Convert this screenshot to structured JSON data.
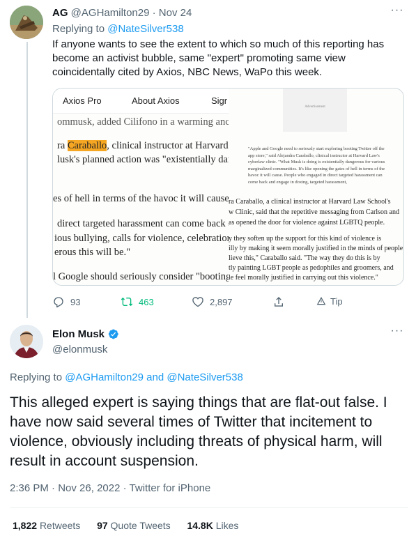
{
  "tweet1": {
    "author_name": "AG",
    "author_handle": "@AGHamilton29",
    "separator": "·",
    "date": "Nov 24",
    "replying_prefix": "Replying to",
    "replying_to": "@NateSilver538",
    "body": "If anyone wants to see the extent to which so much of this reporting has become an activist bubble, same \"expert\" promoting same view coincidentally cited by Axios, NBC News, WaPo this week.",
    "media": {
      "nav_items": [
        "Axios Pro",
        "About Axios",
        "Sigr"
      ],
      "left_lines": [
        "ommusk, added Cilifono in a warming anc",
        "ra ",
        "Caraballo",
        ", clinical instructor at Harvard",
        "lusk's planned action was \"existentially dan",
        "es of hell in terms of the havoc it will cause,",
        "direct targeted harassment can come back a",
        "ious bullying, calls for violence, celebration",
        "erous this will be.\"",
        "l Google should seriously consider \"booting"
      ],
      "ad_label": "Advertisement",
      "small_quote": "\"Apple and Google need to seriously start exploring booting Twitter off the app store,\" said Alejandra Caraballo, clinical instructor at Harvard Law's cyberlaw clinic. \"What Musk is doing is existentially dangerous for various marginalized communities. It's like opening the gates of hell in terms of the havoc it will cause. People who engaged in direct targeted harassment can come back and engage in doxing, targeted harassment,",
      "right_lines": [
        "ra Caraballo, a clinical instructor at Harvard Law School's",
        "w Clinic, said that the repetitive messaging from Carlson and",
        "as opened the door for violence against LGBTQ people.",
        "y they soften up the support for this kind of violence is",
        "illy by making it seem morally justified in the minds of people",
        "lieve this,\" Caraballo said. \"The way they do this is by",
        "tly painting LGBT people as pedophiles and groomers, and",
        "le feel morally justified in carrying out this violence.\""
      ]
    },
    "actions": {
      "replies": "93",
      "retweets": "463",
      "likes": "2,897",
      "tip": "Tip"
    }
  },
  "tweet2": {
    "author_name": "Elon Musk",
    "author_handle": "@elonmusk",
    "replying_prefix": "Replying to",
    "replying_to_1": "@AGHamilton29",
    "replying_and": "and",
    "replying_to_2": "@NateSilver538",
    "body": "This alleged expert is saying things that are flat-out false. I have now said several times of Twitter that incitement to violence, obviously including threats of physical harm, will result in account suspension.",
    "time": "2:36 PM",
    "date": "Nov 26, 2022",
    "source": "Twitter for iPhone",
    "stats": {
      "retweets": "1,822",
      "retweets_label": "Retweets",
      "quotes": "97",
      "quotes_label": "Quote Tweets",
      "likes": "14.8K",
      "likes_label": "Likes"
    }
  },
  "colors": {
    "accent": "#1d9bf0",
    "muted": "#536471",
    "retweet_green": "#00ba7c",
    "highlight": "#f5a623"
  },
  "icons": [
    "more-icon",
    "reply-icon",
    "retweet-icon",
    "like-icon",
    "share-icon",
    "tip-icon",
    "verified-icon"
  ]
}
